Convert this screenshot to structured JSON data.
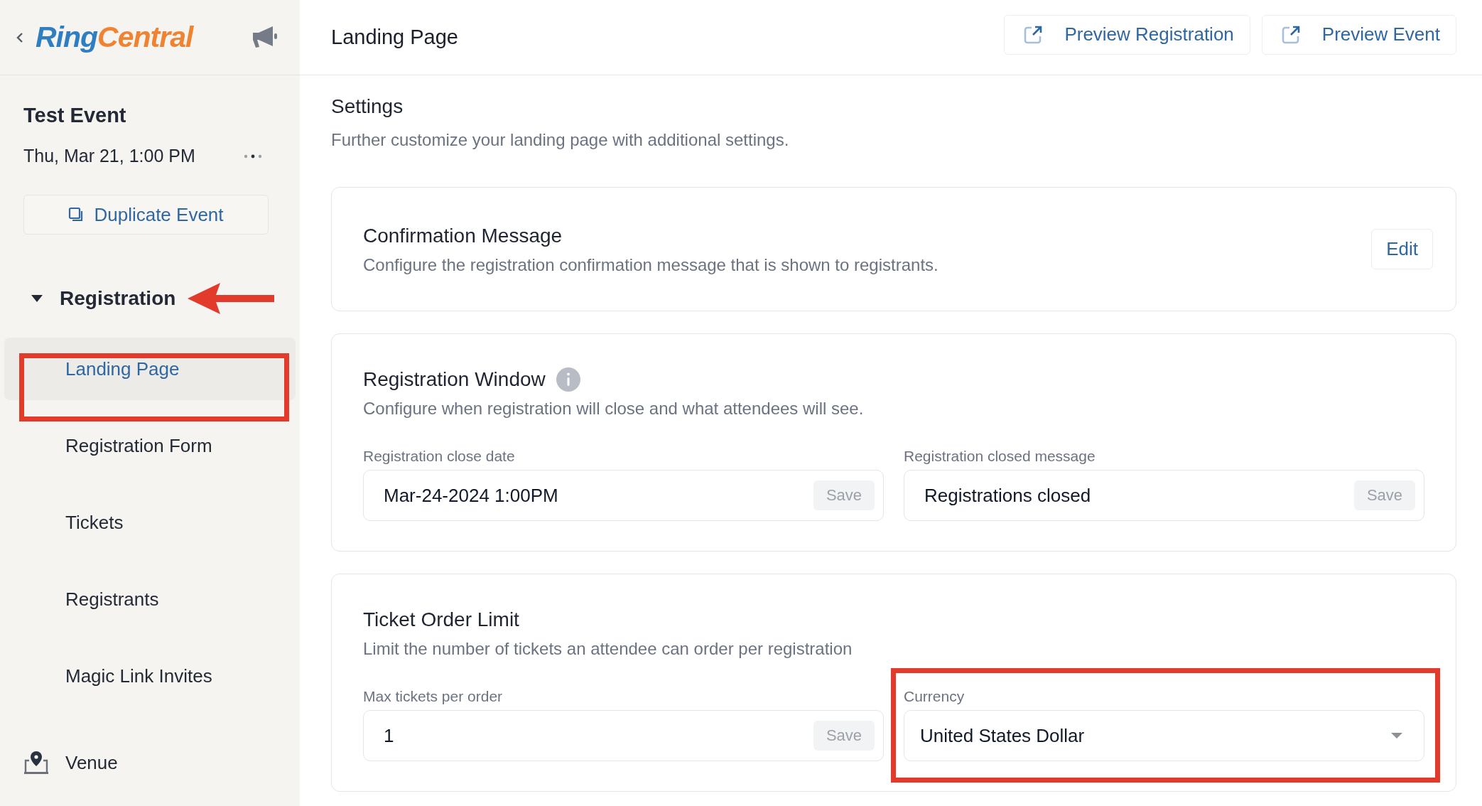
{
  "sidebar": {
    "logo": {
      "first": "Ring",
      "second": "Central"
    },
    "event_title": "Test Event",
    "event_date": "Thu, Mar 21, 1:00 PM",
    "duplicate_button": "Duplicate Event",
    "sections": [
      {
        "kind": "group",
        "label": "Registration",
        "expanded": true,
        "children": [
          {
            "label": "Landing Page",
            "selected": true
          },
          {
            "label": "Registration Form",
            "selected": false
          },
          {
            "label": "Tickets",
            "selected": false
          },
          {
            "label": "Registrants",
            "selected": false
          },
          {
            "label": "Magic Link Invites",
            "selected": false
          }
        ]
      },
      {
        "kind": "venue",
        "label": "Venue",
        "selected": false
      }
    ]
  },
  "header": {
    "title": "Landing Page",
    "buttons": [
      "Preview Registration",
      "Preview Event"
    ]
  },
  "settings": {
    "title": "Settings",
    "description": "Further customize your landing page with additional settings."
  },
  "cards": [
    {
      "kind": "action",
      "title": "Confirmation Message",
      "description": "Configure the registration confirmation message that is shown to registrants.",
      "action": "Edit"
    },
    {
      "kind": "fields",
      "title": "Registration Window",
      "has_info": true,
      "description": "Configure when registration will close and what attendees will see.",
      "fields": [
        {
          "kind": "text",
          "label": "Registration close date",
          "value": "Mar-24-2024 1:00PM",
          "save": "Save",
          "save_disabled": true
        },
        {
          "kind": "text",
          "label": "Registration closed message",
          "value": "Registrations closed",
          "save": "Save",
          "save_disabled": true
        }
      ]
    },
    {
      "kind": "fields",
      "title": "Ticket Order Limit",
      "has_info": false,
      "description": "Limit the number of tickets an attendee can order per registration",
      "fields": [
        {
          "kind": "text",
          "label": "Max tickets per order",
          "value": "1",
          "save": "Save",
          "save_disabled": true
        },
        {
          "kind": "select",
          "label": "Currency",
          "value": "United States Dollar"
        }
      ]
    }
  ]
}
